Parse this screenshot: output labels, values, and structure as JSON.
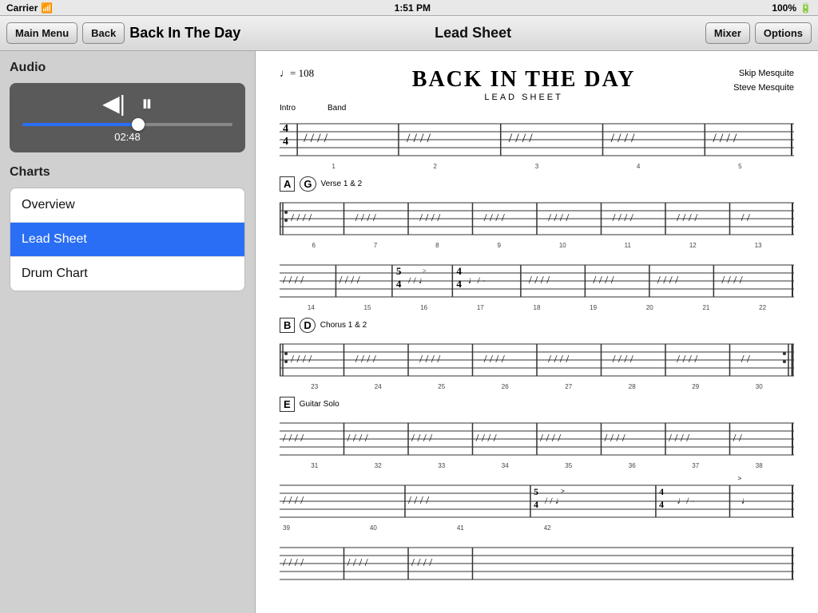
{
  "statusBar": {
    "carrier": "Carrier",
    "time": "1:51 PM",
    "battery": "100%"
  },
  "navBar": {
    "mainMenuLabel": "Main Menu",
    "backLabel": "Back",
    "titleLeft": "Back In The Day",
    "titleCenter": "Lead Sheet",
    "mixerLabel": "Mixer",
    "optionsLabel": "Options"
  },
  "leftPanel": {
    "audioSectionTitle": "Audio",
    "playerTime": "02:48",
    "chartsSectionTitle": "Charts",
    "charts": [
      {
        "id": "overview",
        "label": "Overview",
        "active": false
      },
      {
        "id": "lead-sheet",
        "label": "Lead Sheet",
        "active": true
      },
      {
        "id": "drum-chart",
        "label": "Drum Chart",
        "active": false
      }
    ]
  },
  "sheetMusic": {
    "tempo": "♩= 108",
    "title": "BACK IN THE DAY",
    "subtitle": "LEAD SHEET",
    "composer1": "Skip Mesquite",
    "composer2": "Steve Mesquite",
    "sections": [
      {
        "label": "Intro",
        "label2": "Band",
        "numbers": [
          "1",
          "2",
          "3",
          "4",
          "5"
        ]
      },
      {
        "marker": "A",
        "marker2": "G",
        "label": "Verse 1 & 2",
        "numbers": [
          "6",
          "7",
          "8",
          "9",
          "10",
          "11",
          "12",
          "13"
        ]
      },
      {
        "numbers": [
          "14",
          "15",
          "16",
          "17",
          "18",
          "19",
          "20",
          "21",
          "22"
        ]
      },
      {
        "marker": "B",
        "marker2": "D",
        "label": "Chorus 1 & 2",
        "numbers": [
          "23",
          "24",
          "25",
          "26",
          "27",
          "28",
          "29",
          "30"
        ]
      },
      {
        "marker": "E",
        "label": "Guitar Solo",
        "numbers": [
          "31",
          "32",
          "33",
          "34",
          "35",
          "36",
          "37",
          "38"
        ]
      },
      {
        "numbers": [
          "39",
          "40",
          "41",
          "42"
        ]
      }
    ]
  }
}
